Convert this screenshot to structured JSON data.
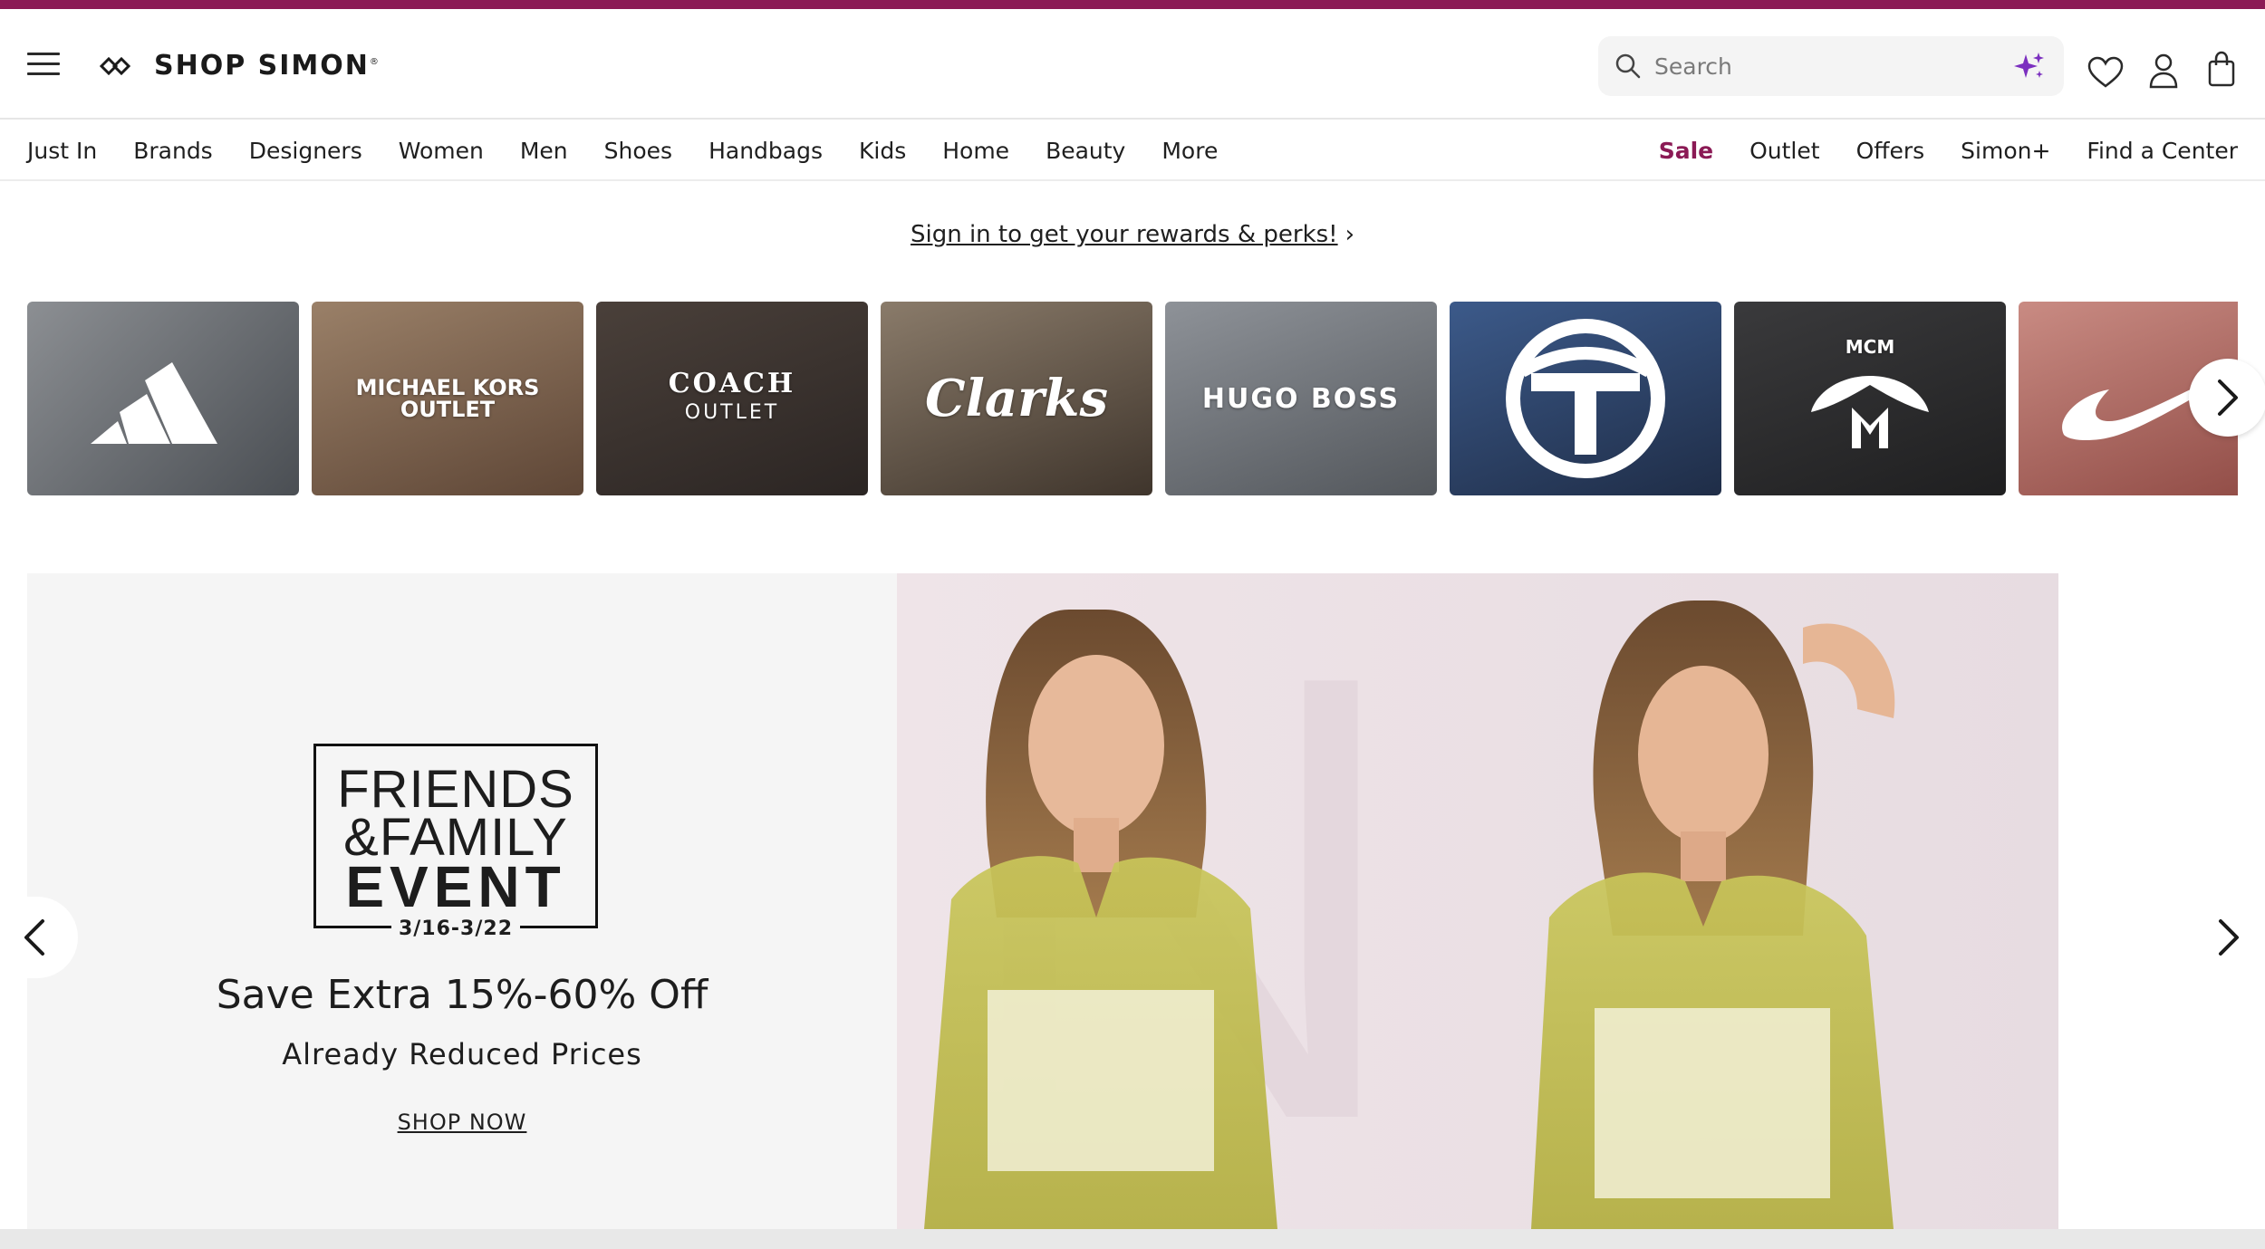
{
  "header": {
    "logo_text": "SHOP SIMON",
    "logo_mark": "®",
    "search_placeholder": "Search"
  },
  "nav": {
    "left": [
      "Just In",
      "Brands",
      "Designers",
      "Women",
      "Men",
      "Shoes",
      "Handbags",
      "Kids",
      "Home",
      "Beauty",
      "More"
    ],
    "right": [
      "Sale",
      "Outlet",
      "Offers",
      "Simon+",
      "Find a Center"
    ]
  },
  "rewards": {
    "text": "Sign in to get your rewards & perks!"
  },
  "brands": [
    {
      "name": "adidas",
      "bg": "#5b5f64"
    },
    {
      "name": "MICHAEL KORS OUTLET",
      "bg": "#6e5644"
    },
    {
      "name": "COACH OUTLET",
      "bg": "#3a3330"
    },
    {
      "name": "Clarks",
      "bg": "#5a4c40"
    },
    {
      "name": "HUGO BOSS",
      "bg": "#6a6e74"
    },
    {
      "name": "Sergio Tacchini",
      "bg": "#3b4a63"
    },
    {
      "name": "MCM",
      "bg": "#2a2a2c"
    },
    {
      "name": "Nike",
      "bg": "#b46b63"
    }
  ],
  "hero": {
    "ff_line1": "FRIENDS",
    "ff_line2": "&FAMILY",
    "ff_line3": "EVENT",
    "ff_date": "3/16-3/22",
    "title": "Save Extra 15%-60% Off",
    "subtitle": "Already Reduced Prices",
    "cta": "SHOP NOW"
  },
  "colors": {
    "brand": "#8b1a55",
    "sparkle": "#7b2fbf"
  },
  "icons": [
    "menu-icon",
    "search-icon",
    "sparkle-icon",
    "heart-icon",
    "user-icon",
    "bag-icon",
    "chevron-right-icon",
    "chevron-left-icon"
  ]
}
